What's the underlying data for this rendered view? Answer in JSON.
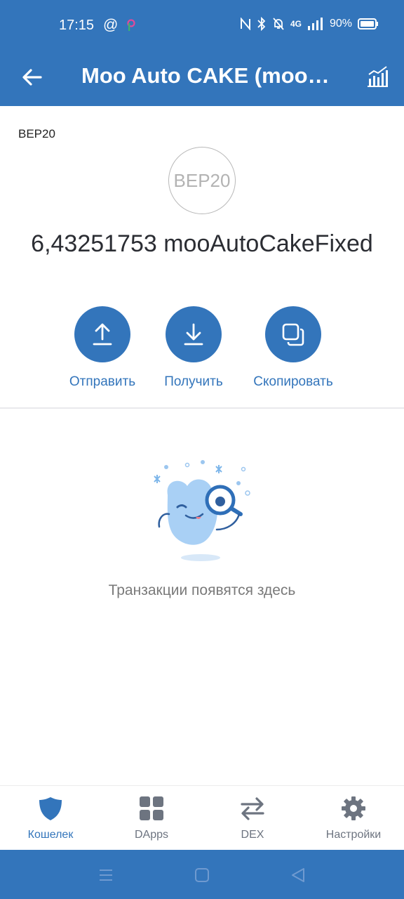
{
  "status_bar": {
    "time": "17:15",
    "at_symbol": "@",
    "network": "4G",
    "battery": "90%"
  },
  "header": {
    "title": "Moo Auto CAKE (mooA...",
    "back_icon": "arrow-left-icon",
    "chart_icon": "chart-icon"
  },
  "token": {
    "network_label": "BEP20",
    "logo_text": "BEP20",
    "balance": "6,43251753 mooAutoCakeFixed"
  },
  "actions": [
    {
      "label": "Отправить",
      "icon": "upload-icon"
    },
    {
      "label": "Получить",
      "icon": "download-icon"
    },
    {
      "label": "Скопировать",
      "icon": "copy-icon"
    }
  ],
  "empty_state": {
    "message": "Транзакции появятся здесь"
  },
  "bottom_nav": [
    {
      "label": "Кошелек",
      "icon": "shield-icon",
      "active": true
    },
    {
      "label": "DApps",
      "icon": "grid-icon",
      "active": false
    },
    {
      "label": "DEX",
      "icon": "swap-icon",
      "active": false
    },
    {
      "label": "Настройки",
      "icon": "gear-icon",
      "active": false
    }
  ],
  "colors": {
    "brand": "#3375bb",
    "inactive": "#6d7480",
    "text_muted": "#7a7a7a"
  }
}
